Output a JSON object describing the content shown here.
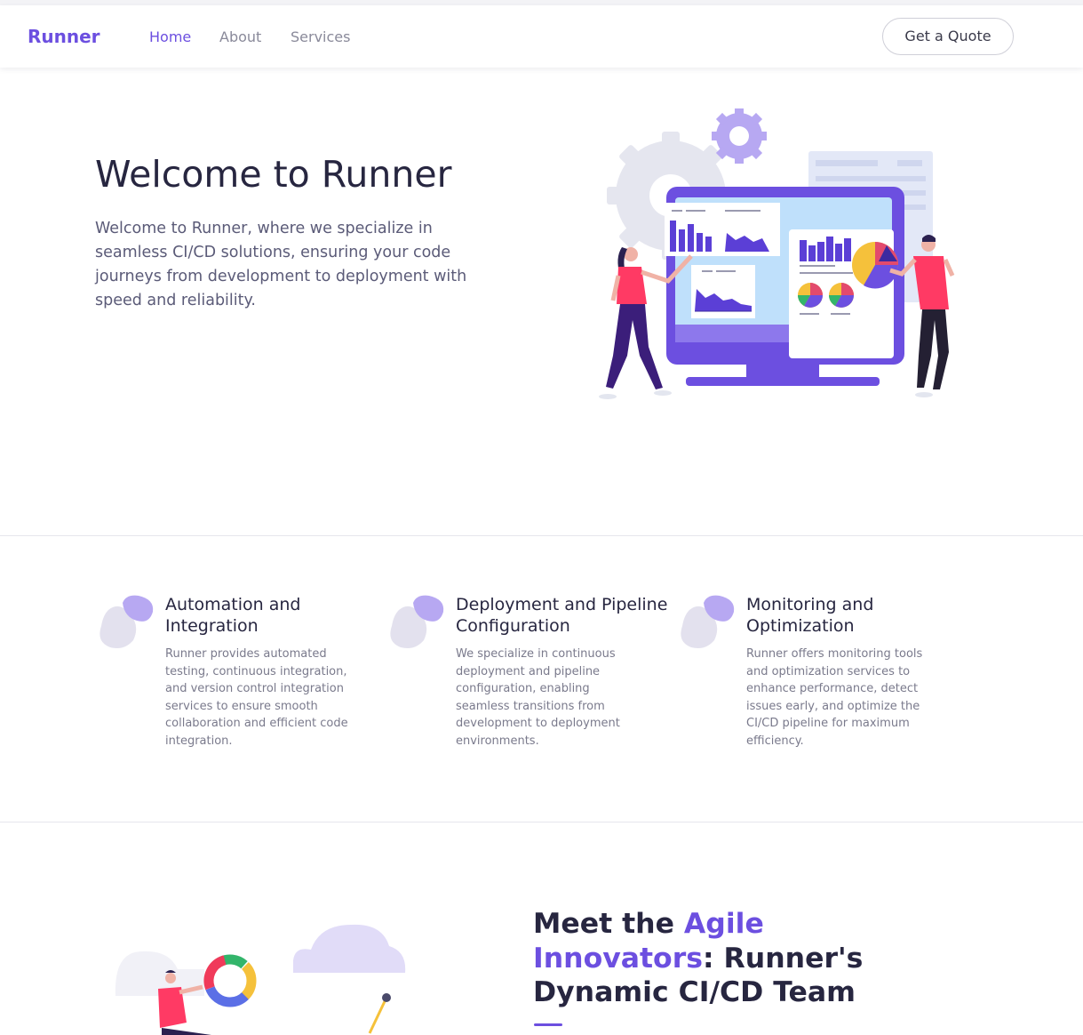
{
  "header": {
    "brand": "Runner",
    "nav": [
      "Home",
      "About",
      "Services"
    ],
    "cta_label": "Get a Quote"
  },
  "hero": {
    "title": "Welcome to Runner",
    "text": "Welcome to Runner, where we specialize in seamless CI/CD solutions, ensuring your code journeys from development to deployment with speed and reliability."
  },
  "features": [
    {
      "title": "Automation and Integration",
      "text": "Runner provides automated testing, continuous integration, and version control integration services to ensure smooth collaboration and efficient code integration."
    },
    {
      "title": "Deployment and Pipeline Configuration",
      "text": "We specialize in continuous deployment and pipeline configuration, enabling seamless transitions from development to deployment environments."
    },
    {
      "title": "Monitoring and Optimization",
      "text": "Runner offers monitoring tools and optimization services to enhance performance, detect issues early, and optimize the CI/CD pipeline for maximum efficiency."
    }
  ],
  "team": {
    "title_pre": "Meet the ",
    "title_accent": "Agile Innovators",
    "title_post": ": Runner's Dynamic CI/CD Team"
  },
  "colors": {
    "accent": "#6c4fe0",
    "heading": "#272640",
    "body": "#5b5b78"
  }
}
